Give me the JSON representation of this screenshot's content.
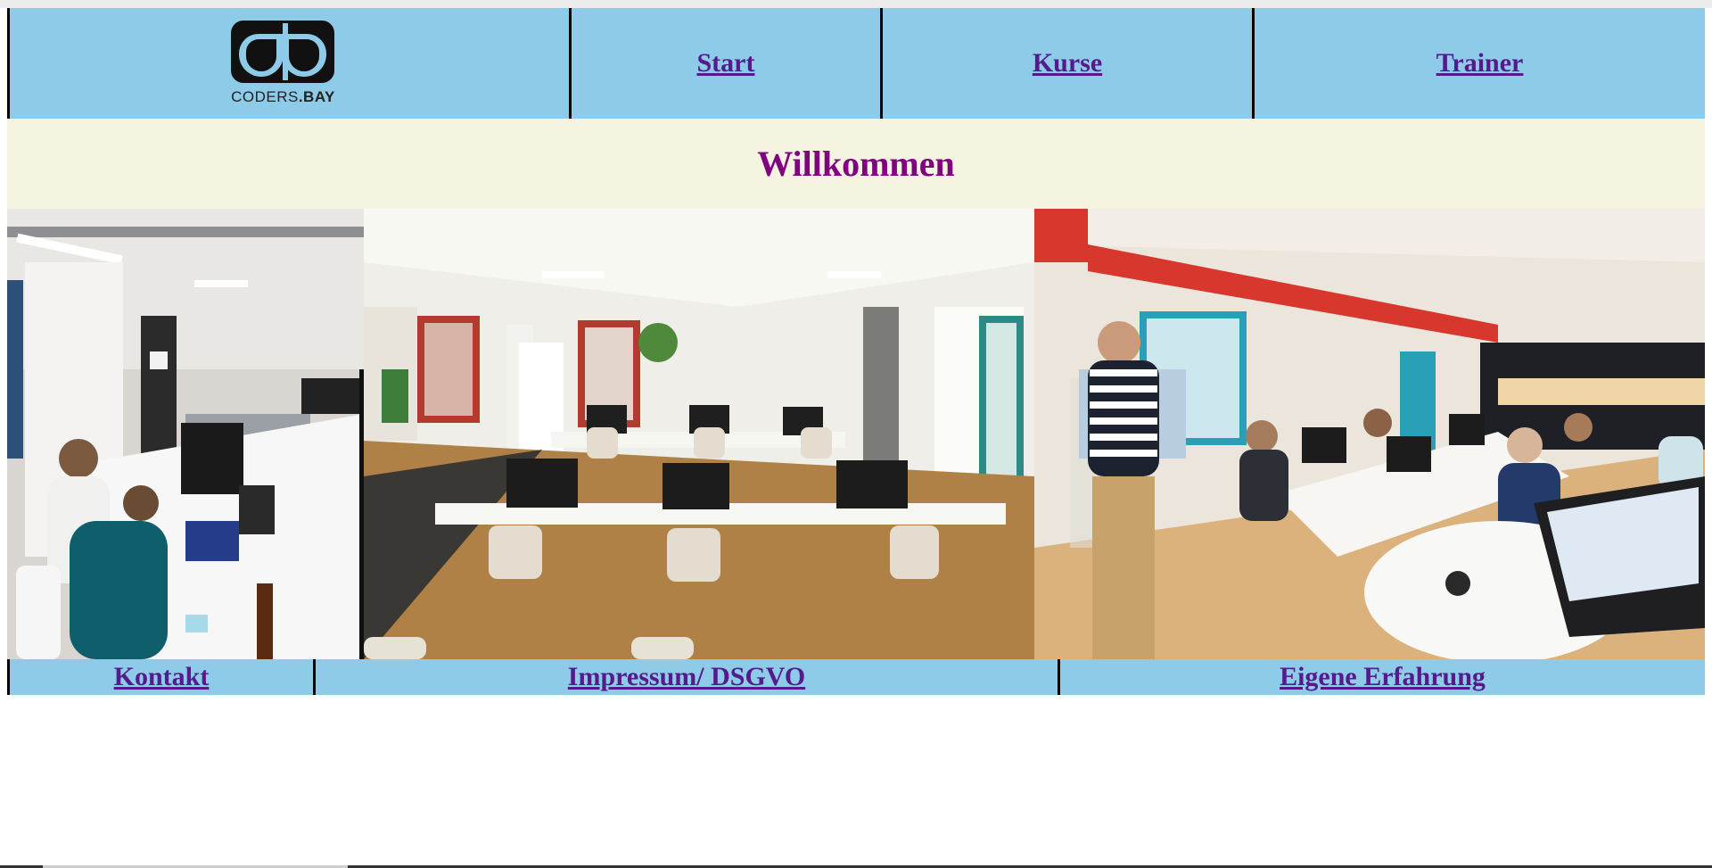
{
  "logo": {
    "text_regular": "CODERS",
    "text_bold": ".BAY"
  },
  "nav": {
    "items": [
      {
        "label": "Start"
      },
      {
        "label": "Kurse"
      },
      {
        "label": "Trainer"
      }
    ]
  },
  "welcome": {
    "title": "Willkommen"
  },
  "footer": {
    "items": [
      {
        "label": "Kontakt"
      },
      {
        "label": "Impressum/ DSGVO"
      },
      {
        "label": "Eigene Erfahrung"
      }
    ]
  },
  "colors": {
    "nav_background": "#8ecbe8",
    "welcome_background": "#f4f4e1",
    "title_color": "#800080",
    "link_color": "#551a8b"
  }
}
